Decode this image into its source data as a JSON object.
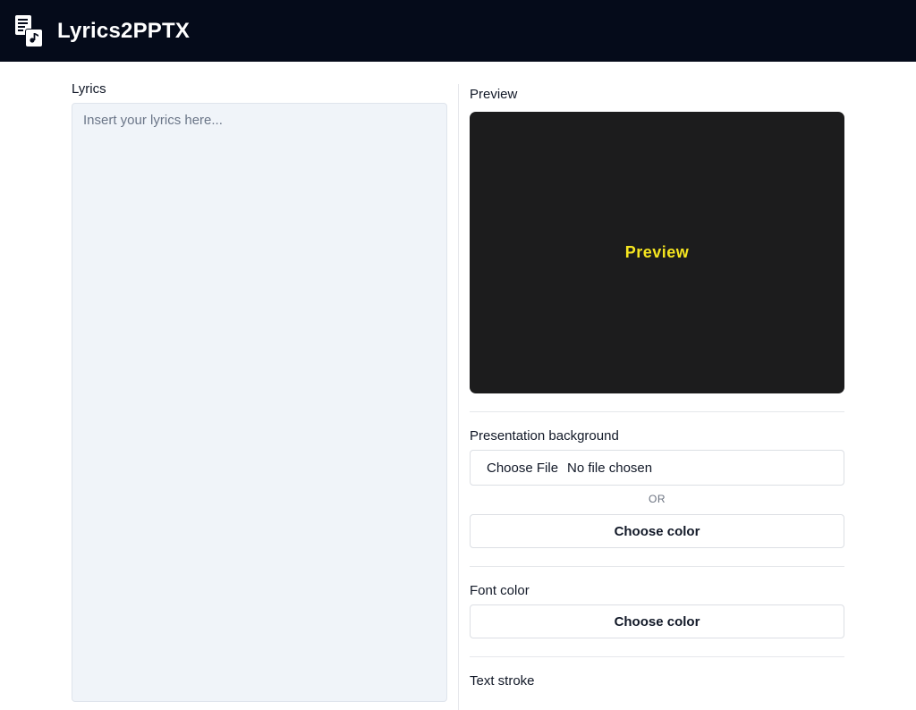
{
  "header": {
    "app_title": "Lyrics2PPTX",
    "logo_icon": "document-music-icon",
    "background_color": "#050b1a"
  },
  "lyrics": {
    "label": "Lyrics",
    "placeholder": "Insert your lyrics here...",
    "value": ""
  },
  "preview": {
    "label": "Preview",
    "text": "Preview",
    "background_color": "#1c1c1d",
    "text_color": "#f5e51f"
  },
  "background_section": {
    "label": "Presentation background",
    "file_button_label": "Choose File",
    "file_status": "No file chosen",
    "or_text": "OR",
    "color_button_label": "Choose color"
  },
  "font_color_section": {
    "label": "Font color",
    "color_button_label": "Choose color"
  },
  "text_stroke_section": {
    "label": "Text stroke"
  }
}
